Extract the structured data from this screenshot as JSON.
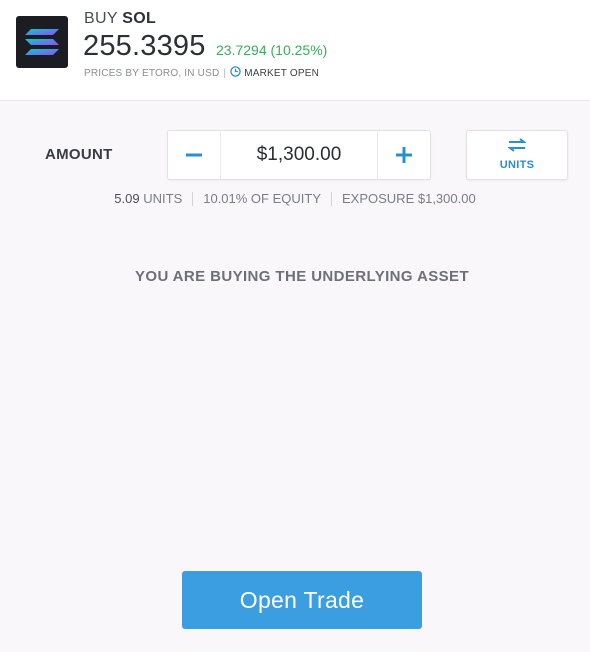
{
  "header": {
    "action": "BUY",
    "symbol": "SOL",
    "price": "255.3395",
    "change": "23.7294 (10.25%)",
    "prices_source": "PRICES BY ETORO, IN USD",
    "separator": "|",
    "market_status": "MARKET OPEN",
    "logo_icon": "solana-logo-icon",
    "change_color": "#35b05a"
  },
  "amount": {
    "label": "AMOUNT",
    "value": "$1,300.00",
    "minus_icon": "minus-icon",
    "plus_icon": "plus-icon"
  },
  "units_toggle": {
    "label": "UNITS",
    "icon": "swap-arrows-icon"
  },
  "info": {
    "units_num": "5.09",
    "units_text": "UNITS",
    "equity": "10.01% OF EQUITY",
    "exposure": "EXPOSURE $1,300.00"
  },
  "note": "YOU ARE BUYING THE UNDERLYING ASSET",
  "open_trade_label": "Open Trade",
  "accent_color": "#3a9ee0"
}
